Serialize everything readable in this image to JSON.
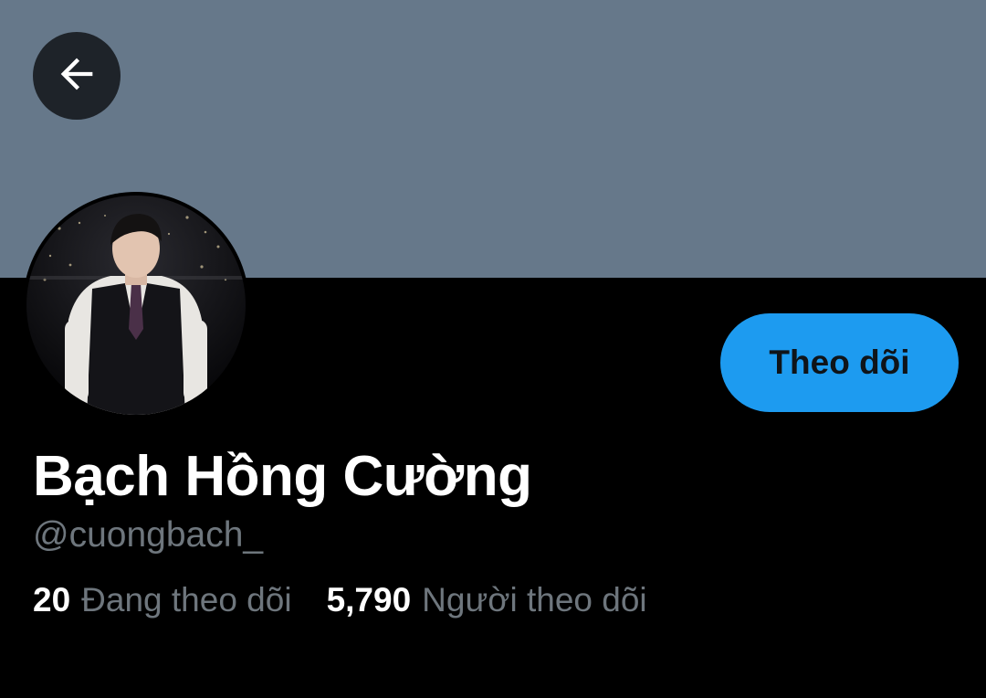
{
  "profile": {
    "display_name": "Bạch Hồng Cường",
    "handle": "@cuongbach_",
    "follow_label": "Theo dõi",
    "avatar": "profile-photo"
  },
  "stats": {
    "following_count": "20",
    "following_label": "Đang theo dõi",
    "followers_count": "5,790",
    "followers_label": "Người theo dõi"
  },
  "nav": {
    "back_icon": "arrow-left-icon"
  },
  "colors": {
    "banner": "#66788a",
    "background": "#000000",
    "accent": "#1d9bf0",
    "secondary_text": "#6e767d"
  }
}
